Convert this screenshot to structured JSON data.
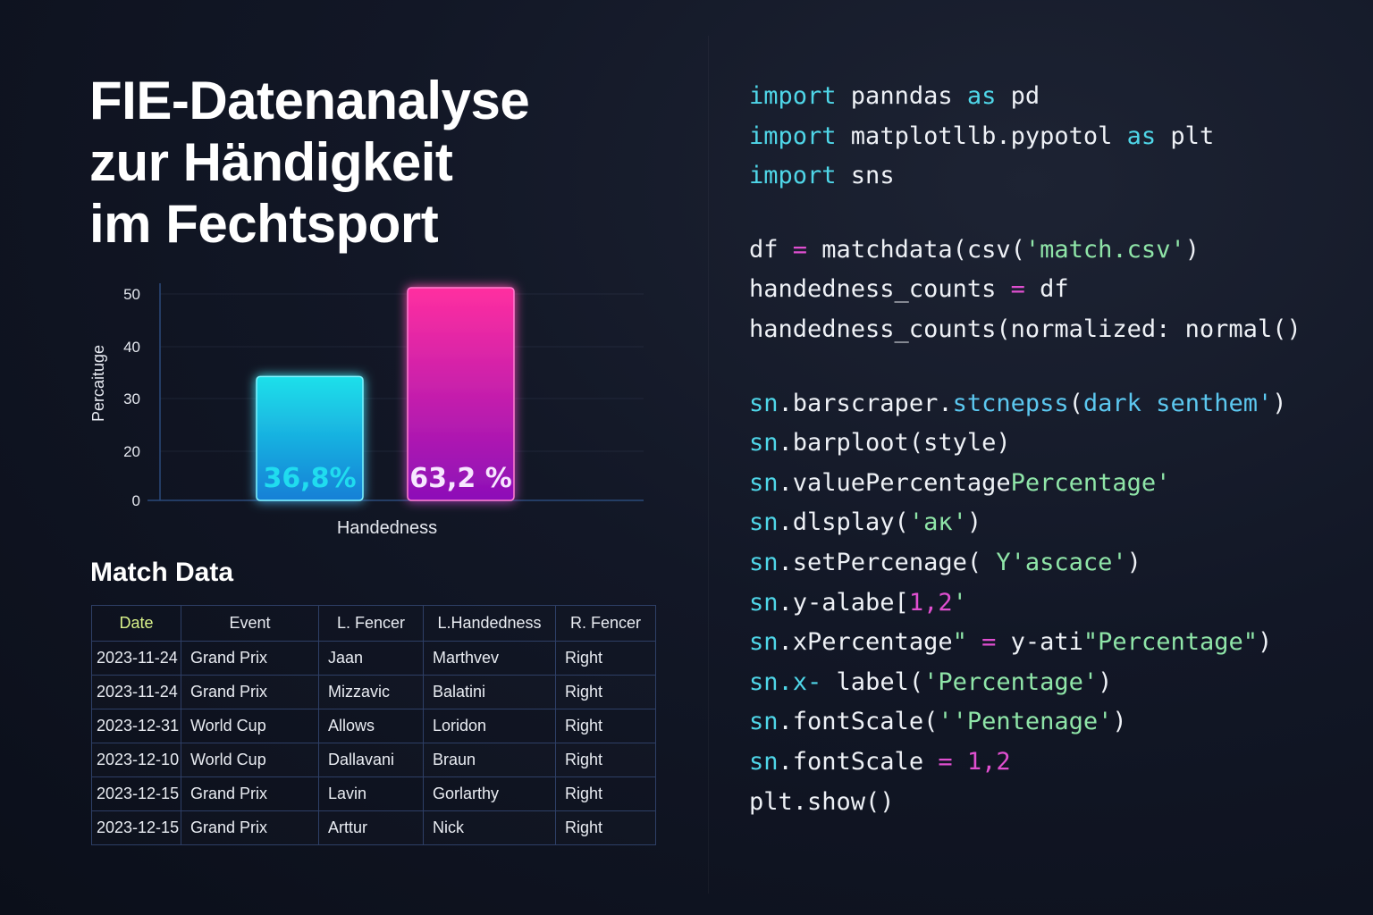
{
  "title_lines": [
    "FIE-Datenanalyse",
    "zur Händigkeit",
    "im Fechtsport"
  ],
  "chart_data": {
    "type": "bar",
    "categories": [
      "",
      ""
    ],
    "values": [
      36.8,
      63.2
    ],
    "data_labels": [
      "36,8%",
      "63,2 %"
    ],
    "ylabel": "Percaituge",
    "xlabel": "Handedness",
    "y_ticks": [
      0,
      20,
      30,
      40,
      50
    ],
    "ylim": [
      0,
      52
    ],
    "grid": true,
    "colors": [
      [
        "#1fe0ea",
        "#127fd6"
      ],
      [
        "#ff2fa0",
        "#8c0fb8"
      ]
    ]
  },
  "table": {
    "title": "Match Data",
    "headers": [
      "Date",
      "Event",
      "L. Fencer",
      "L.Handedness",
      "R. Fencer"
    ],
    "rows": [
      [
        "2023-11-24",
        "Grand Prix",
        "Jaan",
        "Marthvev",
        "Right"
      ],
      [
        "2023-11-24",
        "Grand Prix",
        "Mizzavic",
        "Balatini",
        "Right"
      ],
      [
        "2023-12-31",
        "World Cup",
        "Allows",
        "Loridon",
        "Right"
      ],
      [
        "2023-12-10",
        "World Cup",
        "Dallavani",
        "Braun",
        "Right"
      ],
      [
        "2023-12-15",
        "Grand Prix",
        "Lavin",
        "Gorlarthy",
        "Right"
      ],
      [
        "2023-12-15",
        "Grand Prix",
        "Arttur",
        "Nick",
        "Right"
      ]
    ]
  },
  "code": [
    [
      [
        "import",
        "kw"
      ],
      [
        " panndas ",
        ""
      ],
      [
        "as",
        "kw"
      ],
      [
        " pd",
        ""
      ]
    ],
    [
      [
        "import",
        "kw"
      ],
      [
        " matplotllb.pypotol ",
        ""
      ],
      [
        "as",
        "kw"
      ],
      [
        " plt",
        ""
      ]
    ],
    [
      [
        "import",
        "kw"
      ],
      [
        " sns",
        ""
      ]
    ],
    null,
    [
      [
        "df ",
        ""
      ],
      [
        "=",
        "op"
      ],
      [
        " matchdata(csv(",
        ""
      ],
      [
        "'match.csv'",
        "str"
      ],
      [
        ")",
        ""
      ]
    ],
    [
      [
        "handedness_counts ",
        ""
      ],
      [
        "=",
        "op"
      ],
      [
        " df",
        ""
      ]
    ],
    [
      [
        "handedness_counts(normalized: normal()",
        ""
      ]
    ],
    null,
    [
      [
        "sn",
        "kw"
      ],
      [
        ".barscraper.",
        ""
      ],
      [
        "stcnepss",
        "fn"
      ],
      [
        "(",
        ""
      ],
      [
        "dark senthem'",
        "fn"
      ],
      [
        ")",
        ""
      ]
    ],
    [
      [
        "sn",
        "kw"
      ],
      [
        ".barploot(style)",
        ""
      ]
    ],
    [
      [
        "sn",
        "kw"
      ],
      [
        ".valuePercentage",
        ""
      ],
      [
        "Percentage'",
        "str"
      ]
    ],
    [
      [
        "sn",
        "kw"
      ],
      [
        ".dlsplay(",
        ""
      ],
      [
        "'aĸ'",
        "str"
      ],
      [
        ")",
        ""
      ]
    ],
    [
      [
        "sn",
        "kw"
      ],
      [
        ".setPercenage( ",
        ""
      ],
      [
        "Y'ascace'",
        "str"
      ],
      [
        ")",
        ""
      ]
    ],
    [
      [
        "sn",
        "kw"
      ],
      [
        ".y-alabe[",
        ""
      ],
      [
        "1,2",
        "num"
      ],
      [
        "'",
        "str"
      ]
    ],
    [
      [
        "sn",
        "kw"
      ],
      [
        ".xPercentage",
        ""
      ],
      [
        "\"",
        "str"
      ],
      [
        " = ",
        "op"
      ],
      [
        "y-ati",
        ""
      ],
      [
        "\"Percentage\"",
        "str"
      ],
      [
        ")",
        ""
      ]
    ],
    [
      [
        "sn",
        "kw"
      ],
      [
        ".x-",
        "kw"
      ],
      [
        " label(",
        ""
      ],
      [
        "'Percentage'",
        "str"
      ],
      [
        ")",
        ""
      ]
    ],
    [
      [
        "sn",
        "kw"
      ],
      [
        ".fontScale(",
        ""
      ],
      [
        "''Pentenage'",
        "str"
      ],
      [
        ")",
        ""
      ]
    ],
    [
      [
        "sn",
        "kw"
      ],
      [
        ".fontScale ",
        ""
      ],
      [
        "=",
        "op"
      ],
      [
        " ",
        ""
      ],
      [
        "1,2",
        "num"
      ]
    ],
    [
      [
        "plt.show()",
        ""
      ]
    ]
  ]
}
